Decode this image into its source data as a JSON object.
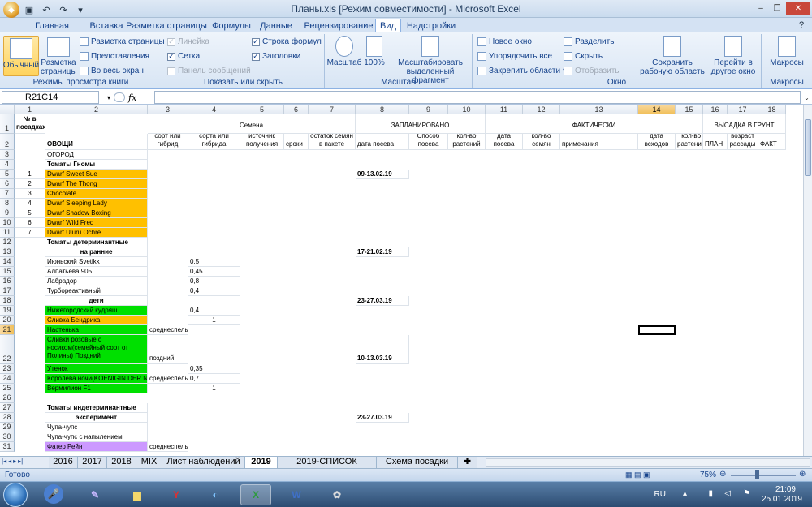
{
  "window": {
    "title": "Планы.xls  [Режим совместимости] - Microsoft Excel"
  },
  "ribbon_tabs": [
    "Главная",
    "Вставка",
    "Разметка страницы",
    "Формулы",
    "Данные",
    "Рецензирование",
    "Вид",
    "Надстройки"
  ],
  "active_tab": "Вид",
  "ribbon": {
    "views": {
      "normal": "Обычный",
      "page_layout": "Разметка страницы",
      "page_break": "Разметка страницы",
      "custom_views": "Представления",
      "full_screen": "Во весь экран",
      "label": "Режимы просмотра книги"
    },
    "show": {
      "ruler": "Линейка",
      "gridlines": "Сетка",
      "messages": "Панель сообщений",
      "formula_bar": "Строка формул",
      "headings": "Заголовки",
      "label": "Показать или скрыть"
    },
    "zoom": {
      "zoom": "Масштаб",
      "zoom100": "100%",
      "zoom_sel": "Масштабировать выделенный фрагмент",
      "label": "Масштаб"
    },
    "window": {
      "new": "Новое окно",
      "arrange": "Упорядочить все",
      "freeze": "Закрепить области",
      "split": "Разделить",
      "hide": "Скрыть",
      "unhide": "Отобразить",
      "save_ws": "Сохранить рабочую область",
      "switch": "Перейти в другое окно",
      "label": "Окно"
    },
    "macros": {
      "macros": "Макросы",
      "label": "Макросы"
    }
  },
  "formula_bar": {
    "name_box": "R21C14",
    "fx": "fx",
    "value": ""
  },
  "columns": [
    "1",
    "2",
    "3",
    "4",
    "5",
    "6",
    "7",
    "8",
    "9",
    "10",
    "11",
    "12",
    "13",
    "14",
    "15",
    "16",
    "17",
    "18"
  ],
  "rows": [
    "1",
    "2",
    "3",
    "4",
    "5",
    "6",
    "7",
    "8",
    "9",
    "10",
    "11",
    "12",
    "13",
    "14",
    "15",
    "16",
    "17",
    "18",
    "19",
    "20",
    "21",
    "22",
    "23",
    "24",
    "25",
    "26",
    "27",
    "28",
    "29",
    "30",
    "31"
  ],
  "headers": {
    "n_posadka": "№ в посадках",
    "ovoshchi": "ОВОЩИ",
    "semena": "Семена",
    "zaplanirovano": "ЗАПЛАНИРОВАНО",
    "fakticheski": "ФАКТИЧЕСКИ",
    "vysadka": "ВЫСАДКА В ГРУНТ",
    "sort": "сорт или гибрид",
    "harakteristika": "характеристика сорта или гибрида",
    "istochnik": "источник получения",
    "sroki": "сроки",
    "ostatok": "остаток семян в пакете",
    "data_poseva": "дата посева",
    "sposob": "Способ посева",
    "kolvo_rast": "кол-во растений",
    "data_poseva2": "дата посева",
    "kolvo_semyan": "кол-во семян",
    "primechaniya": "примечания",
    "data_vshodov": "дата всходов",
    "kolvo_rast2": "кол-во растений",
    "plan": "ПЛАН",
    "vozrast": "возраст рассады",
    "fakt": "ФАКТ"
  },
  "cells": {
    "r3": "ОГОРОД",
    "r4": "Томаты Гномы",
    "r5n": "1",
    "r5": "Dwarf Sweet Sue",
    "r5d": "09-13.02.19",
    "r6n": "2",
    "r6": "Dwarf The Thong",
    "r7n": "3",
    "r7": "Chocolate",
    "r8n": "4",
    "r8": "Dwarf Sleeping Lady",
    "r9n": "5",
    "r9": "Dwarf Shadow Boxing",
    "r10n": "6",
    "r10": "Dwarf Wild Fred",
    "r11n": "7",
    "r11": "Dwarf  Uluru Ochre",
    "r12": "Томаты детерминантные",
    "r13": "на ранние",
    "r13d": "17-21.02.19",
    "r14": "Июньский Svetikk",
    "r14v": "0,5",
    "r15": "Алпатьева 905",
    "r15v": "0,45",
    "r16": "Лабрадор",
    "r16v": "0,8",
    "r17": "Турбореактивный",
    "r17v": "0,4",
    "r18": "дети",
    "r18d": "23-27.03.19",
    "r19": "Нижегородский кудряш",
    "r19v": "0,4",
    "r20": "Сливка Бендрика",
    "r20v": "1",
    "r21": "Настенька",
    "r21s": "среднеспелый",
    "r22": "Сливки розовые с носиком(семейный сорт от Полины) Поздний",
    "r22s": "поздний",
    "r22d": "10-13.03.19",
    "r23": "Утенок",
    "r23v": "0,35",
    "r24": "Королева ночи(KOENIGIN DER NACHT)",
    "r24s": "среднеспелы",
    "r24v": "0,7",
    "r25": "Вермилион F1",
    "r25v": "1",
    "r27": "Томаты индетерминантные",
    "r28": "эксперимент",
    "r28d": "23-27.03.19",
    "r29": "Чупа-чупс",
    "r30": "Чупа-чупс с напылением",
    "r31": "Фатер Рейн",
    "r31s": "среднеспелый"
  },
  "sheet_tabs": [
    "2016",
    "2017",
    "2018",
    "MIX",
    "Лист наблюдений",
    "2019",
    "2019-СПИСОК СОРТОВ",
    "Схема посадки"
  ],
  "active_sheet": "2019",
  "status": {
    "ready": "Готово",
    "zoom": "75%"
  },
  "taskbar": {
    "lang": "RU",
    "time": "21:09",
    "date": "25.01.2019"
  },
  "colors": {
    "orange": "#ffc000",
    "green": "#00e000",
    "purple": "#cc99ff",
    "selection": "#000000"
  }
}
